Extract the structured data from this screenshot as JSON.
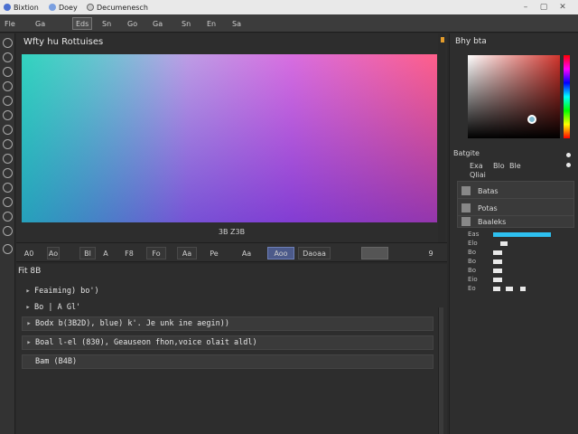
{
  "window": {
    "menu": [
      "Bixtion",
      "Doey",
      "Decumenesch"
    ],
    "controls": [
      "–",
      "▢",
      "✕"
    ]
  },
  "toolbar": {
    "buttons": [
      "Fle",
      "Ga",
      "Eds",
      "Sn",
      "Go",
      "Ga",
      "Sn",
      "En",
      "Sa"
    ]
  },
  "canvas": {
    "title": "Wfty hu Rottuises",
    "caption": "3B Z3B"
  },
  "controls": {
    "items": [
      "A0",
      "Ao",
      "Bl",
      "A",
      "F8",
      "Fo",
      "Aa",
      "Pe",
      "Aa",
      "Aoo",
      "Daoaa",
      "",
      "9"
    ]
  },
  "console": {
    "header": "Fit   8B",
    "lines": [
      "Feaiming) bo')",
      "Bo | A   Gl'",
      "Bodx b(3B2D), blue) k'. Je unk ine aegin))",
      "Boal l-el (830), Geauseon fhon,voice olait aldl)",
      "Bam  (B4B)"
    ]
  },
  "right_panel": {
    "title": "Bhy bta",
    "section": "Batgite",
    "sub": "Qliai",
    "tabs": [
      "Exa",
      "Blo",
      "Ble"
    ],
    "layers": [
      "Batas",
      "Potas",
      "Baaleks"
    ],
    "props": [
      "Eas",
      "Elo",
      "Bo",
      "Bo",
      "Bo",
      "Eio",
      "Eo"
    ]
  },
  "colors": {
    "accent": "#e39c2c",
    "highlight": "#4c5a8a",
    "slider_blue": "#2ec0f0"
  }
}
